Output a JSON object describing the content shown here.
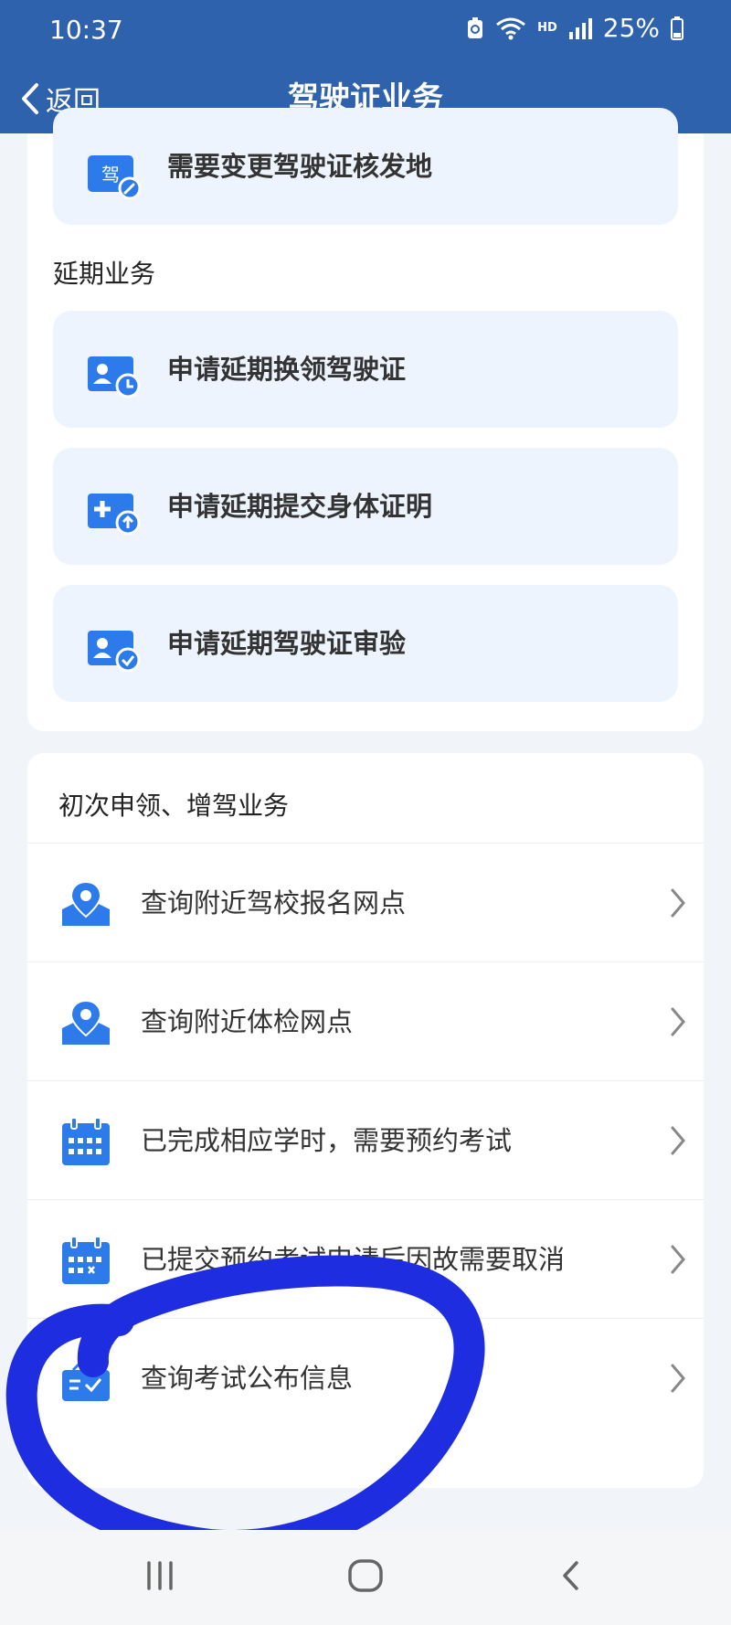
{
  "status_bar": {
    "time": "10:37",
    "network": "HD",
    "battery": "25%"
  },
  "nav": {
    "back_label": "返回",
    "title": "驾驶证业务"
  },
  "top_tiles": [
    {
      "label": "需要变更驾驶证核发地",
      "icon": "license-edit-icon"
    }
  ],
  "extension_section": {
    "title": "延期业务",
    "items": [
      {
        "label": "申请延期换领驾驶证",
        "icon": "user-clock-icon"
      },
      {
        "label": "申请延期提交身体证明",
        "icon": "medical-upload-icon"
      },
      {
        "label": "申请延期驾驶证审验",
        "icon": "user-check-icon"
      }
    ]
  },
  "first_license_section": {
    "title": "初次申领、增驾业务",
    "items": [
      {
        "label": "查询附近驾校报名网点",
        "icon": "location-pin-icon"
      },
      {
        "label": "查询附近体检网点",
        "icon": "location-pin-icon"
      },
      {
        "label": "已完成相应学时，需要预约考试",
        "icon": "calendar-icon"
      },
      {
        "label": "已提交预约考试申请后因故需要取消",
        "icon": "calendar-cancel-icon"
      },
      {
        "label": "查询考试公布信息",
        "icon": "notice-board-icon"
      }
    ]
  },
  "license_badge_char": "驾",
  "colors": {
    "primary": "#2f62ac",
    "icon_blue": "#2d7bea",
    "tile_bg": "#edf4fd",
    "annotation": "#1e2de0"
  }
}
